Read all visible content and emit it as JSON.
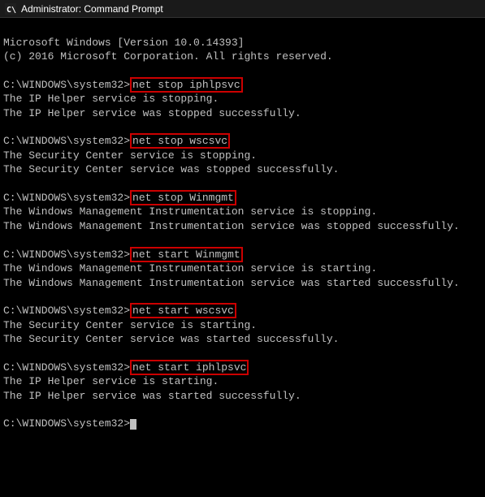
{
  "titleBar": {
    "icon": "C:\\",
    "title": "Administrator: Command Prompt"
  },
  "terminal": {
    "lines": [
      {
        "text": "Microsoft Windows [Version 10.0.14393]",
        "type": "plain"
      },
      {
        "text": "(c) 2016 Microsoft Corporation. All rights reserved.",
        "type": "plain"
      },
      {
        "text": "",
        "type": "plain"
      },
      {
        "text": "C:\\WINDOWS\\system32>",
        "type": "prompt",
        "cmd": "net stop iphlpsvc"
      },
      {
        "text": "The IP Helper service is stopping.",
        "type": "plain"
      },
      {
        "text": "The IP Helper service was stopped successfully.",
        "type": "plain"
      },
      {
        "text": "",
        "type": "plain"
      },
      {
        "text": "C:\\WINDOWS\\system32>",
        "type": "prompt",
        "cmd": "net stop wscsvc"
      },
      {
        "text": "The Security Center service is stopping.",
        "type": "plain"
      },
      {
        "text": "The Security Center service was stopped successfully.",
        "type": "plain"
      },
      {
        "text": "",
        "type": "plain"
      },
      {
        "text": "C:\\WINDOWS\\system32>",
        "type": "prompt",
        "cmd": "net stop Winmgmt"
      },
      {
        "text": "The Windows Management Instrumentation service is stopping.",
        "type": "plain"
      },
      {
        "text": "The Windows Management Instrumentation service was stopped successfully.",
        "type": "plain"
      },
      {
        "text": "",
        "type": "plain"
      },
      {
        "text": "C:\\WINDOWS\\system32>",
        "type": "prompt",
        "cmd": "net start Winmgmt"
      },
      {
        "text": "The Windows Management Instrumentation service is starting.",
        "type": "plain"
      },
      {
        "text": "The Windows Management Instrumentation service was started successfully.",
        "type": "plain"
      },
      {
        "text": "",
        "type": "plain"
      },
      {
        "text": "C:\\WINDOWS\\system32>",
        "type": "prompt",
        "cmd": "net start wscsvc"
      },
      {
        "text": "The Security Center service is starting.",
        "type": "plain"
      },
      {
        "text": "The Security Center service was started successfully.",
        "type": "plain"
      },
      {
        "text": "",
        "type": "plain"
      },
      {
        "text": "C:\\WINDOWS\\system32>",
        "type": "prompt",
        "cmd": "net start iphlpsvc"
      },
      {
        "text": "The IP Helper service is starting.",
        "type": "plain"
      },
      {
        "text": "The IP Helper service was started successfully.",
        "type": "plain"
      },
      {
        "text": "",
        "type": "plain"
      },
      {
        "text": "C:\\WINDOWS\\system32>",
        "type": "cursor"
      }
    ]
  }
}
